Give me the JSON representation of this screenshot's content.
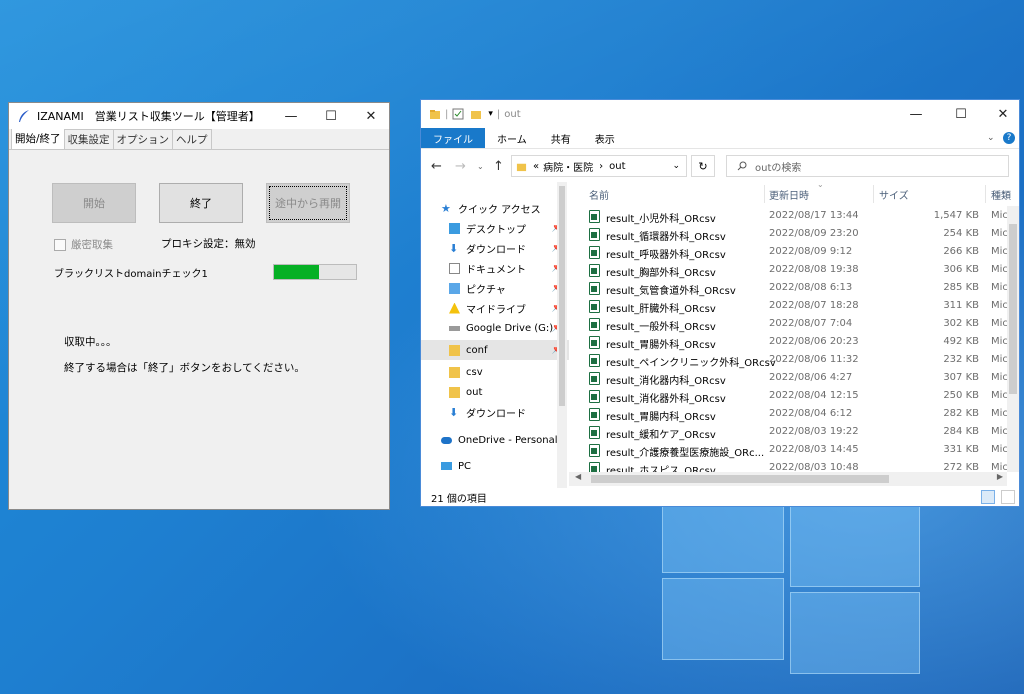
{
  "izanami": {
    "title": "IZANAMI　営業リスト収集ツール【管理者】",
    "controls": {
      "minimize": "—",
      "maximize": "☐",
      "close": "✕"
    },
    "tabs": [
      "開始/終了",
      "収集設定",
      "オプション",
      "ヘルプ"
    ],
    "buttons": {
      "start": "開始",
      "end": "終了",
      "resume": "途中から再開"
    },
    "strict_label": "厳密取集",
    "proxy_label": "プロキシ設定：無効",
    "blacklist_label": "ブラックリストdomainチェック1",
    "progress_fraction": 0.55,
    "status_collecting": "収取中。。。",
    "status_instruction": "終了する場合は「終了」ボタンをおしてください。"
  },
  "explorer": {
    "title": "out",
    "controls": {
      "minimize": "—",
      "maximize": "☐",
      "close": "✕"
    },
    "ribbon_tabs": [
      "ファイル",
      "ホーム",
      "共有",
      "表示"
    ],
    "breadcrumb": [
      "«",
      "病院・医院",
      "›",
      "out"
    ],
    "search_placeholder": "outの検索",
    "nav": [
      {
        "label": "クイック アクセス",
        "icon": "star-icon",
        "pinned": false
      },
      {
        "label": "デスクトップ",
        "icon": "desktop-icon",
        "pinned": true
      },
      {
        "label": "ダウンロード",
        "icon": "download-icon",
        "pinned": true
      },
      {
        "label": "ドキュメント",
        "icon": "document-icon",
        "pinned": true
      },
      {
        "label": "ピクチャ",
        "icon": "picture-icon",
        "pinned": true
      },
      {
        "label": "マイドライブ",
        "icon": "drive-icon",
        "pinned": true
      },
      {
        "label": "Google Drive (G:)",
        "icon": "disk-icon",
        "pinned": true
      },
      {
        "label": "conf",
        "icon": "folder-icon",
        "pinned": true
      },
      {
        "label": "csv",
        "icon": "folder-icon",
        "pinned": false
      },
      {
        "label": "out",
        "icon": "folder-icon",
        "pinned": false
      },
      {
        "label": "ダウンロード",
        "icon": "download-icon",
        "pinned": false
      },
      {
        "label": "OneDrive - Personal",
        "icon": "cloud-icon",
        "pinned": false
      },
      {
        "label": "PC",
        "icon": "pc-icon",
        "pinned": false
      }
    ],
    "columns": {
      "name": "名前",
      "date": "更新日時",
      "size": "サイズ",
      "type": "種類"
    },
    "files": [
      {
        "name": "result_小児外科_ORcsv",
        "date": "2022/08/17 13:44",
        "size": "1,547 KB",
        "type": "Mic"
      },
      {
        "name": "result_循環器外科_ORcsv",
        "date": "2022/08/09 23:20",
        "size": "254 KB",
        "type": "Mic"
      },
      {
        "name": "result_呼吸器外科_ORcsv",
        "date": "2022/08/09 9:12",
        "size": "266 KB",
        "type": "Mic"
      },
      {
        "name": "result_胸部外科_ORcsv",
        "date": "2022/08/08 19:38",
        "size": "306 KB",
        "type": "Mic"
      },
      {
        "name": "result_気管食道外科_ORcsv",
        "date": "2022/08/08 6:13",
        "size": "285 KB",
        "type": "Mic"
      },
      {
        "name": "result_肝臓外科_ORcsv",
        "date": "2022/08/07 18:28",
        "size": "311 KB",
        "type": "Mic"
      },
      {
        "name": "result_一般外科_ORcsv",
        "date": "2022/08/07 7:04",
        "size": "302 KB",
        "type": "Mic"
      },
      {
        "name": "result_胃腸外科_ORcsv",
        "date": "2022/08/06 20:23",
        "size": "492 KB",
        "type": "Mic"
      },
      {
        "name": "result_ペインクリニック外科_ORcsv",
        "date": "2022/08/06 11:32",
        "size": "232 KB",
        "type": "Mic"
      },
      {
        "name": "result_消化器内科_ORcsv",
        "date": "2022/08/06 4:27",
        "size": "307 KB",
        "type": "Mic"
      },
      {
        "name": "result_消化器外科_ORcsv",
        "date": "2022/08/04 12:15",
        "size": "250 KB",
        "type": "Mic"
      },
      {
        "name": "result_胃腸内科_ORcsv",
        "date": "2022/08/04 6:12",
        "size": "282 KB",
        "type": "Mic"
      },
      {
        "name": "result_緩和ケア_ORcsv",
        "date": "2022/08/03 19:22",
        "size": "284 KB",
        "type": "Mic"
      },
      {
        "name": "result_介護療養型医療施設_ORc...",
        "date": "2022/08/03 14:45",
        "size": "331 KB",
        "type": "Mic"
      },
      {
        "name": "result_ホスピス_ORcsv",
        "date": "2022/08/03 10:48",
        "size": "272 KB",
        "type": "Mic"
      }
    ],
    "status": "21 個の項目"
  }
}
